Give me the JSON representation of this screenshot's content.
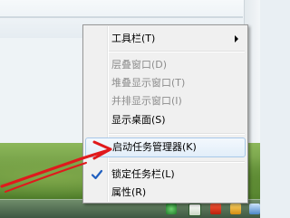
{
  "context_menu": {
    "items": [
      {
        "label": "工具栏(T)",
        "enabled": true,
        "submenu": true
      },
      {
        "label": "层叠窗口(D)",
        "enabled": false
      },
      {
        "label": "堆叠显示窗口(T)",
        "enabled": false
      },
      {
        "label": "并排显示窗口(I)",
        "enabled": false
      },
      {
        "label": "显示桌面(S)",
        "enabled": true
      },
      {
        "label": "启动任务管理器(K)",
        "enabled": true,
        "highlighted": true
      },
      {
        "label": "锁定任务栏(L)",
        "enabled": true,
        "checked": true
      },
      {
        "label": "属性(R)",
        "enabled": true
      }
    ]
  },
  "annotation": {
    "color": "#e0191c",
    "icon": "red-arrow-annotation"
  },
  "colors": {
    "menu_background": "#f0f0f0",
    "highlight_border": "#a8c8e8",
    "disabled_text": "#8d8d8d",
    "check_color": "#1f5fbf",
    "desktop_green": "#6f9a3f"
  }
}
